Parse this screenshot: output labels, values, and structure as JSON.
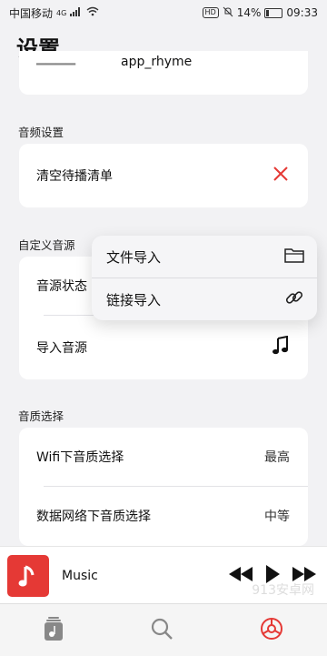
{
  "status": {
    "carrier": "中国移动",
    "net": "4G",
    "hd": "HD",
    "battery": "14%",
    "time": "09:33"
  },
  "page": {
    "title": "设置"
  },
  "top_row": {
    "value": "app_rhyme"
  },
  "audio": {
    "label": "音频设置",
    "clear_queue": "清空待播清单"
  },
  "custom_source": {
    "label": "自定义音源",
    "status": "音源状态",
    "import": "导入音源"
  },
  "popup": {
    "file_import": "文件导入",
    "link_import": "链接导入"
  },
  "quality": {
    "label": "音质选择",
    "wifi": "Wifi下音质选择",
    "wifi_value": "最高",
    "mobile": "数据网络下音质选择",
    "mobile_value": "中等"
  },
  "player": {
    "title": "Music"
  },
  "watermark": "913安卓网",
  "colors": {
    "accent": "#e53935"
  }
}
